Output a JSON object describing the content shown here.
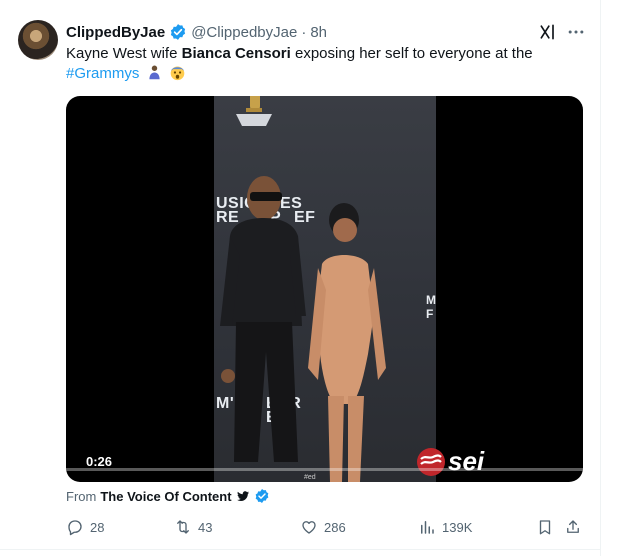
{
  "tweet": {
    "display_name": "ClippedByJae",
    "handle": "@ClippedbyJae",
    "separator": "·",
    "time": "8h",
    "text_part1": "Kayne West wife ",
    "text_bold": "Bianca Censori",
    "text_part2": " exposing her self to everyone at the",
    "hashtag": "#Grammys",
    "emoji_1": "person-bowing-emoji",
    "emoji_2": "shocked-face-emoji"
  },
  "media": {
    "duration": "0:26",
    "progress": 0.0,
    "backdrop_line1": "USIC",
    "backdrop_line2": "ES",
    "backdrop_line3": "RE",
    "backdrop_line4": "P",
    "backdrop_line5": "EF",
    "backdrop_line6": "M'",
    "backdrop_line7": "EAR",
    "backdrop_line8": "ELI",
    "backdrop_right1": "M",
    "backdrop_right2": "F",
    "watermark_text": "sei",
    "small_tag": "#ed"
  },
  "source": {
    "prefix": "From",
    "name": "The Voice Of Content"
  },
  "actions": {
    "replies": "28",
    "reposts": "43",
    "likes": "286",
    "views": "139K"
  },
  "colors": {
    "accent": "#1d9bf0",
    "muted": "#536471",
    "text": "#0f1419"
  },
  "icons": {
    "verified": "verified-badge-icon",
    "grok": "grok-icon",
    "more": "more-icon",
    "reply": "reply-icon",
    "repost": "repost-icon",
    "like": "heart-icon",
    "views": "views-icon",
    "bookmark": "bookmark-icon",
    "share": "share-icon",
    "bird": "bird-icon"
  }
}
